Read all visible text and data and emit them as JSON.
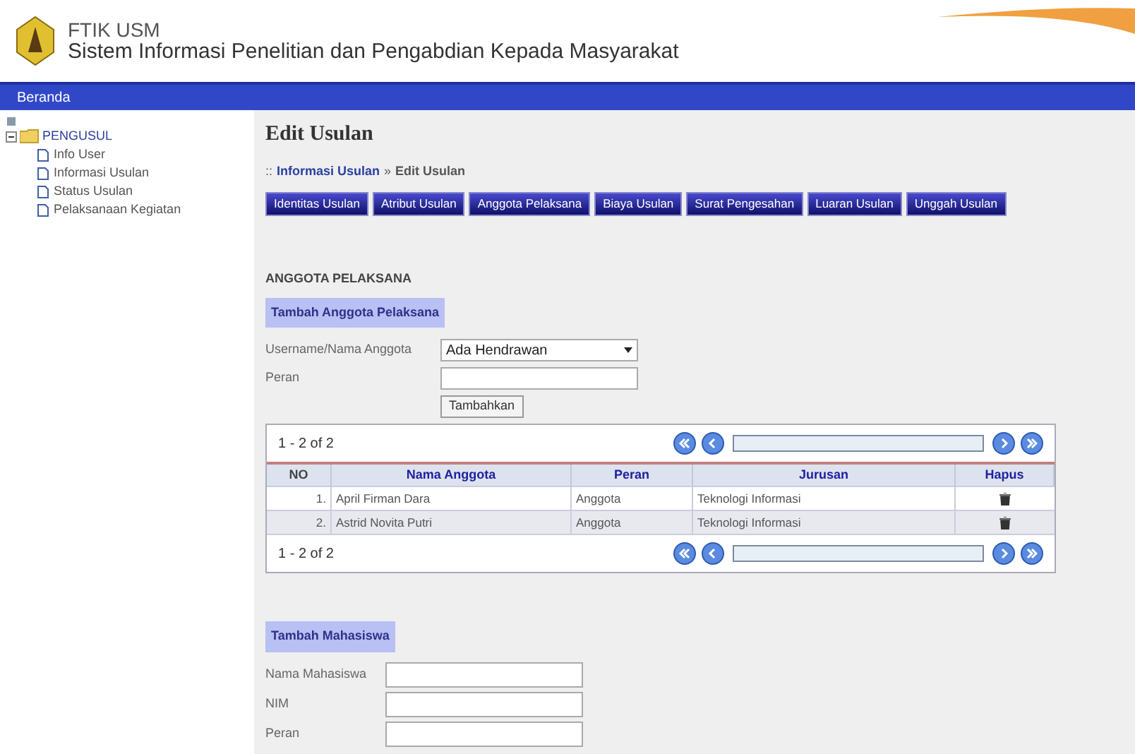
{
  "header": {
    "org": "FTIK USM",
    "system": "Sistem Informasi Penelitian dan Pengabdian Kepada Masyarakat"
  },
  "navbar": {
    "items": [
      "Beranda"
    ]
  },
  "sidebar": {
    "tree": [
      {
        "label": "PENGUSUL",
        "expanded": true,
        "children": [
          {
            "label": "Info User"
          },
          {
            "label": "Informasi Usulan"
          },
          {
            "label": "Status Usulan"
          },
          {
            "label": "Pelaksanaan Kegiatan"
          }
        ]
      }
    ]
  },
  "page_title": "Edit Usulan",
  "breadcrumb": {
    "prefix": "::",
    "link": "Informasi Usulan",
    "separator": "»",
    "current": "Edit Usulan"
  },
  "tabs": [
    {
      "label": "Identitas Usulan"
    },
    {
      "label": "Atribut Usulan"
    },
    {
      "label": "Anggota Pelaksana"
    },
    {
      "label": "Biaya Usulan"
    },
    {
      "label": "Surat Pengesahan"
    },
    {
      "label": "Luaran Usulan"
    },
    {
      "label": "Unggah Usulan"
    }
  ],
  "section_title": "ANGGOTA PELAKSANA",
  "member_form": {
    "heading": "Tambah Anggota Pelaksana",
    "fields": [
      {
        "kind": "select",
        "label": "Username/Nama Anggota",
        "value": "Ada Hendrawan"
      },
      {
        "kind": "text",
        "label": "Peran"
      }
    ],
    "button": "Tambahkan"
  },
  "table": {
    "pager_top": "1 - 2 of 2",
    "pager_bottom": "1 - 2 of 2",
    "columns": [
      "NO",
      "Nama Anggota",
      "Peran",
      "Jurusan",
      "Hapus"
    ],
    "rows": [
      {
        "no": "1.",
        "nama": "April Firman Dara",
        "peran": "Anggota",
        "jurusan": "Teknologi Informasi"
      },
      {
        "no": "2.",
        "nama": "Astrid Novita Putri",
        "peran": "Anggota",
        "jurusan": "Teknologi Informasi"
      }
    ]
  },
  "student_form": {
    "heading": "Tambah Mahasiswa",
    "fields": [
      {
        "label": "Nama Mahasiswa"
      },
      {
        "label": "NIM"
      },
      {
        "label": "Peran"
      }
    ]
  }
}
